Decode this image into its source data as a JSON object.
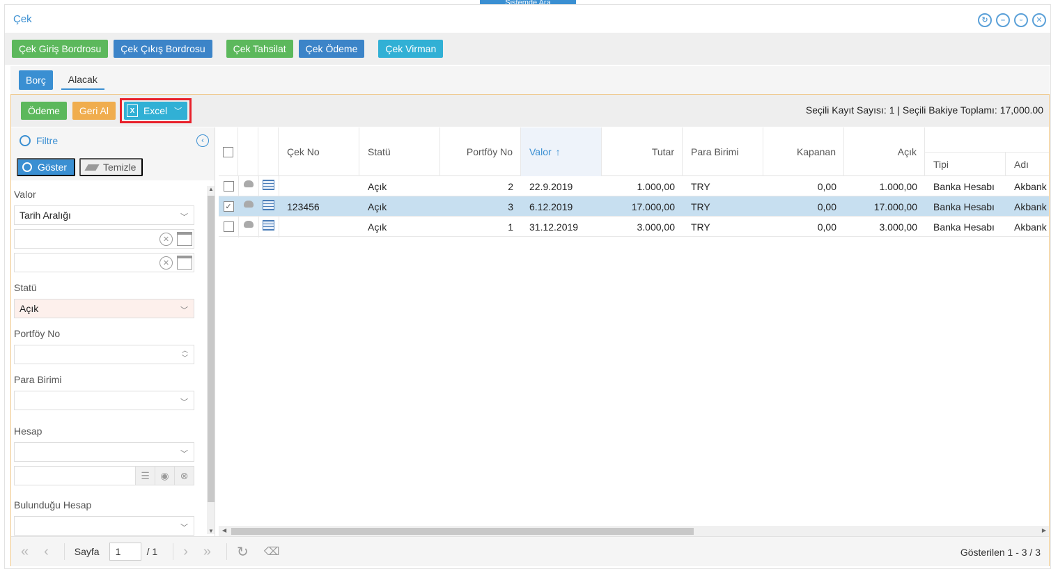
{
  "top_peek": "Sistemde Ara",
  "window": {
    "title": "Çek"
  },
  "toolbar": {
    "giris": "Çek Giriş Bordrosu",
    "cikis": "Çek Çıkış Bordrosu",
    "tahsilat": "Çek Tahsilat",
    "odeme": "Çek Ödeme",
    "virman": "Çek Virman"
  },
  "tabs": {
    "borc": "Borç",
    "alacak": "Alacak"
  },
  "actions": {
    "odeme": "Ödeme",
    "geri_al": "Geri Al",
    "excel": "Excel"
  },
  "summary": "Seçili Kayıt Sayısı: 1   | Seçili Bakiye Toplamı: 17,000.00",
  "filter": {
    "title": "Filtre",
    "goster": "Göster",
    "temizle": "Temizle",
    "valor_label": "Valor",
    "valor_mode": "Tarih Aralığı",
    "statu_label": "Statü",
    "statu_value": "Açık",
    "portfoy_label": "Portföy No",
    "para_label": "Para Birimi",
    "hesap_label": "Hesap",
    "bulundugu_label": "Bulunduğu Hesap"
  },
  "grid": {
    "headers": {
      "cek_no": "Çek No",
      "statu": "Statü",
      "portfoy": "Portföy No",
      "valor": "Valor",
      "tutar": "Tutar",
      "para": "Para Birimi",
      "kapanan": "Kapanan",
      "acik": "Açık",
      "tipi": "Tipi",
      "adi": "Adı"
    },
    "rows": [
      {
        "cek_no": "",
        "statu": "Açık",
        "portfoy": "2",
        "valor": "22.9.2019",
        "tutar": "1.000,00",
        "para": "TRY",
        "kapanan": "0,00",
        "acik": "1.000,00",
        "tipi": "Banka Hesabı",
        "adi": "Akbank Ç"
      },
      {
        "cek_no": "123456",
        "statu": "Açık",
        "portfoy": "3",
        "valor": "6.12.2019",
        "tutar": "17.000,00",
        "para": "TRY",
        "kapanan": "0,00",
        "acik": "17.000,00",
        "tipi": "Banka Hesabı",
        "adi": "Akbank Ç"
      },
      {
        "cek_no": "",
        "statu": "Açık",
        "portfoy": "1",
        "valor": "31.12.2019",
        "tutar": "3.000,00",
        "para": "TRY",
        "kapanan": "0,00",
        "acik": "3.000,00",
        "tipi": "Banka Hesabı",
        "adi": "Akbank Ç"
      }
    ]
  },
  "pager": {
    "label": "Sayfa",
    "current": "1",
    "total": "/ 1",
    "shown": "Gösterilen 1 - 3 / 3"
  }
}
